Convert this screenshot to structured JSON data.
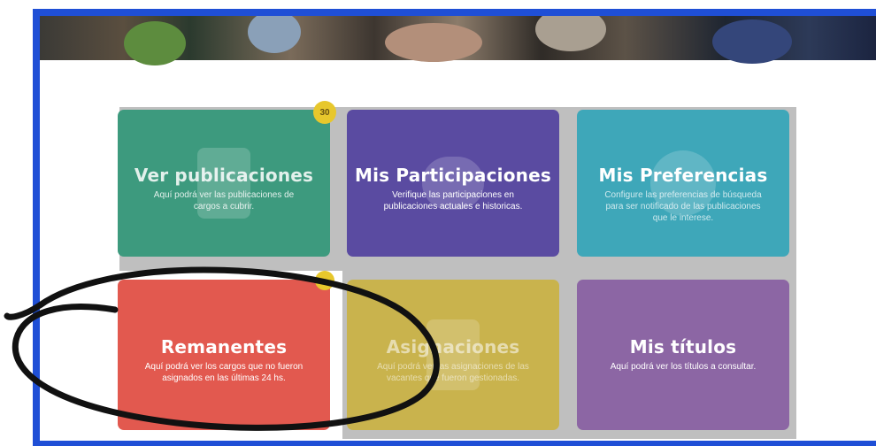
{
  "cards": [
    {
      "title": "Ver publicaciones",
      "desc": "Aquí podrá ver las publicaciones de cargos a cubrir.",
      "badge": "30",
      "color": "#3d9a7e"
    },
    {
      "title": "Mis Participaciones",
      "desc": "Verifique las participaciones en publicaciones actuales e historicas.",
      "color": "#5a4ba1"
    },
    {
      "title": "Mis Preferencias",
      "desc": "Configure las preferencias de búsqueda para ser notificado de las publicaciones que le interese.",
      "color": "#3ea7b9"
    },
    {
      "title": "Remanentes",
      "desc": "Aquí podrá ver los cargos que no fueron asignados en las últimas 24 hs.",
      "color": "#e2594f"
    },
    {
      "title": "Asignaciones",
      "desc": "Aquí podrá ver las asignaciones de las vacantes que fueron gestionadas.",
      "color": "#c9b34d"
    },
    {
      "title": "Mis títulos",
      "desc": "Aquí podrá ver los títulos a consultar.",
      "color": "#8c66a4"
    }
  ],
  "annotation": {
    "color": "#111111",
    "highlights": "Remanentes"
  }
}
